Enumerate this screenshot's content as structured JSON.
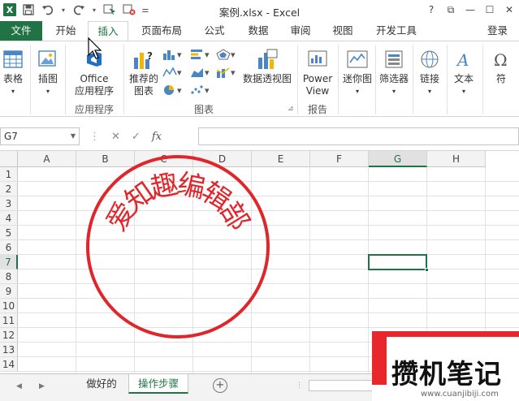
{
  "title": "案例.xlsx - Excel",
  "window_controls": {
    "help": "?",
    "restore_ribbon": "⧉",
    "minimize": "—",
    "maximize": "☐",
    "close": "✕"
  },
  "tabs": [
    "开始",
    "插入",
    "页面布局",
    "公式",
    "数据",
    "审阅",
    "视图",
    "开发工具"
  ],
  "file_tab": "文件",
  "active_tab": "插入",
  "login": "登录",
  "ribbon": {
    "table": "表格",
    "illustrations": "插图",
    "office_apps_1": "Office",
    "office_apps_2": "应用程序",
    "recommended_1": "推荐的",
    "recommended_2": "图表",
    "pivotchart": "数据透视图",
    "power_1": "Power",
    "power_2": "View",
    "sparklines": "迷你图",
    "slicer": "筛选器",
    "link": "链接",
    "text": "文本",
    "symbol": "符",
    "groups": {
      "apps": "应用程序",
      "charts": "图表",
      "reports": "报告"
    }
  },
  "namebox": "G7",
  "fx_label": "fx",
  "columns": [
    "A",
    "B",
    "C",
    "D",
    "E",
    "F",
    "G",
    "H"
  ],
  "rows": [
    "1",
    "2",
    "3",
    "4",
    "5",
    "6",
    "7",
    "8",
    "9",
    "10",
    "11",
    "12",
    "13",
    "14"
  ],
  "selected_column": "G",
  "selected_row": "7",
  "stamp_text": "爱知趣编辑部",
  "stamp_color": "#e0262b",
  "accent_color": "#217346",
  "sheets": [
    "做好的",
    "操作步骤"
  ],
  "active_sheet": "操作步骤",
  "add_sheet": "+",
  "watermark": {
    "text": "攒机笔记",
    "url": "www.cuanjibiji.com"
  }
}
